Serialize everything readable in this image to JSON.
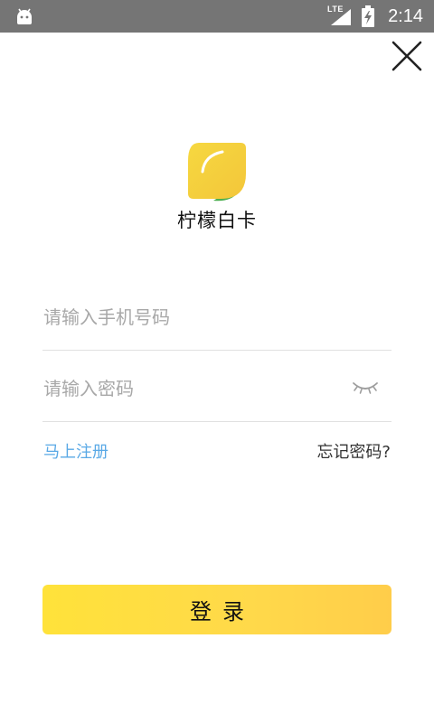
{
  "status_bar": {
    "network": "LTE",
    "time": "2:14",
    "icons": [
      "android-icon",
      "signal-icon",
      "battery-charging-icon"
    ]
  },
  "app": {
    "name": "柠檬白卡",
    "logo": "lemon-leaf-logo"
  },
  "login_form": {
    "phone_placeholder": "请输入手机号码",
    "phone_value": "",
    "password_placeholder": "请输入密码",
    "password_value": "",
    "password_toggle_icon": "eye-closed-icon",
    "register_label": "马上注册",
    "forgot_label": "忘记密码?",
    "login_label": "登录"
  },
  "colors": {
    "status_bar": "#757575",
    "link_blue": "#5aa9e6",
    "button_yellow": "#ffe23a",
    "logo_yellow": "#f6d23c",
    "logo_green": "#4caf50"
  }
}
